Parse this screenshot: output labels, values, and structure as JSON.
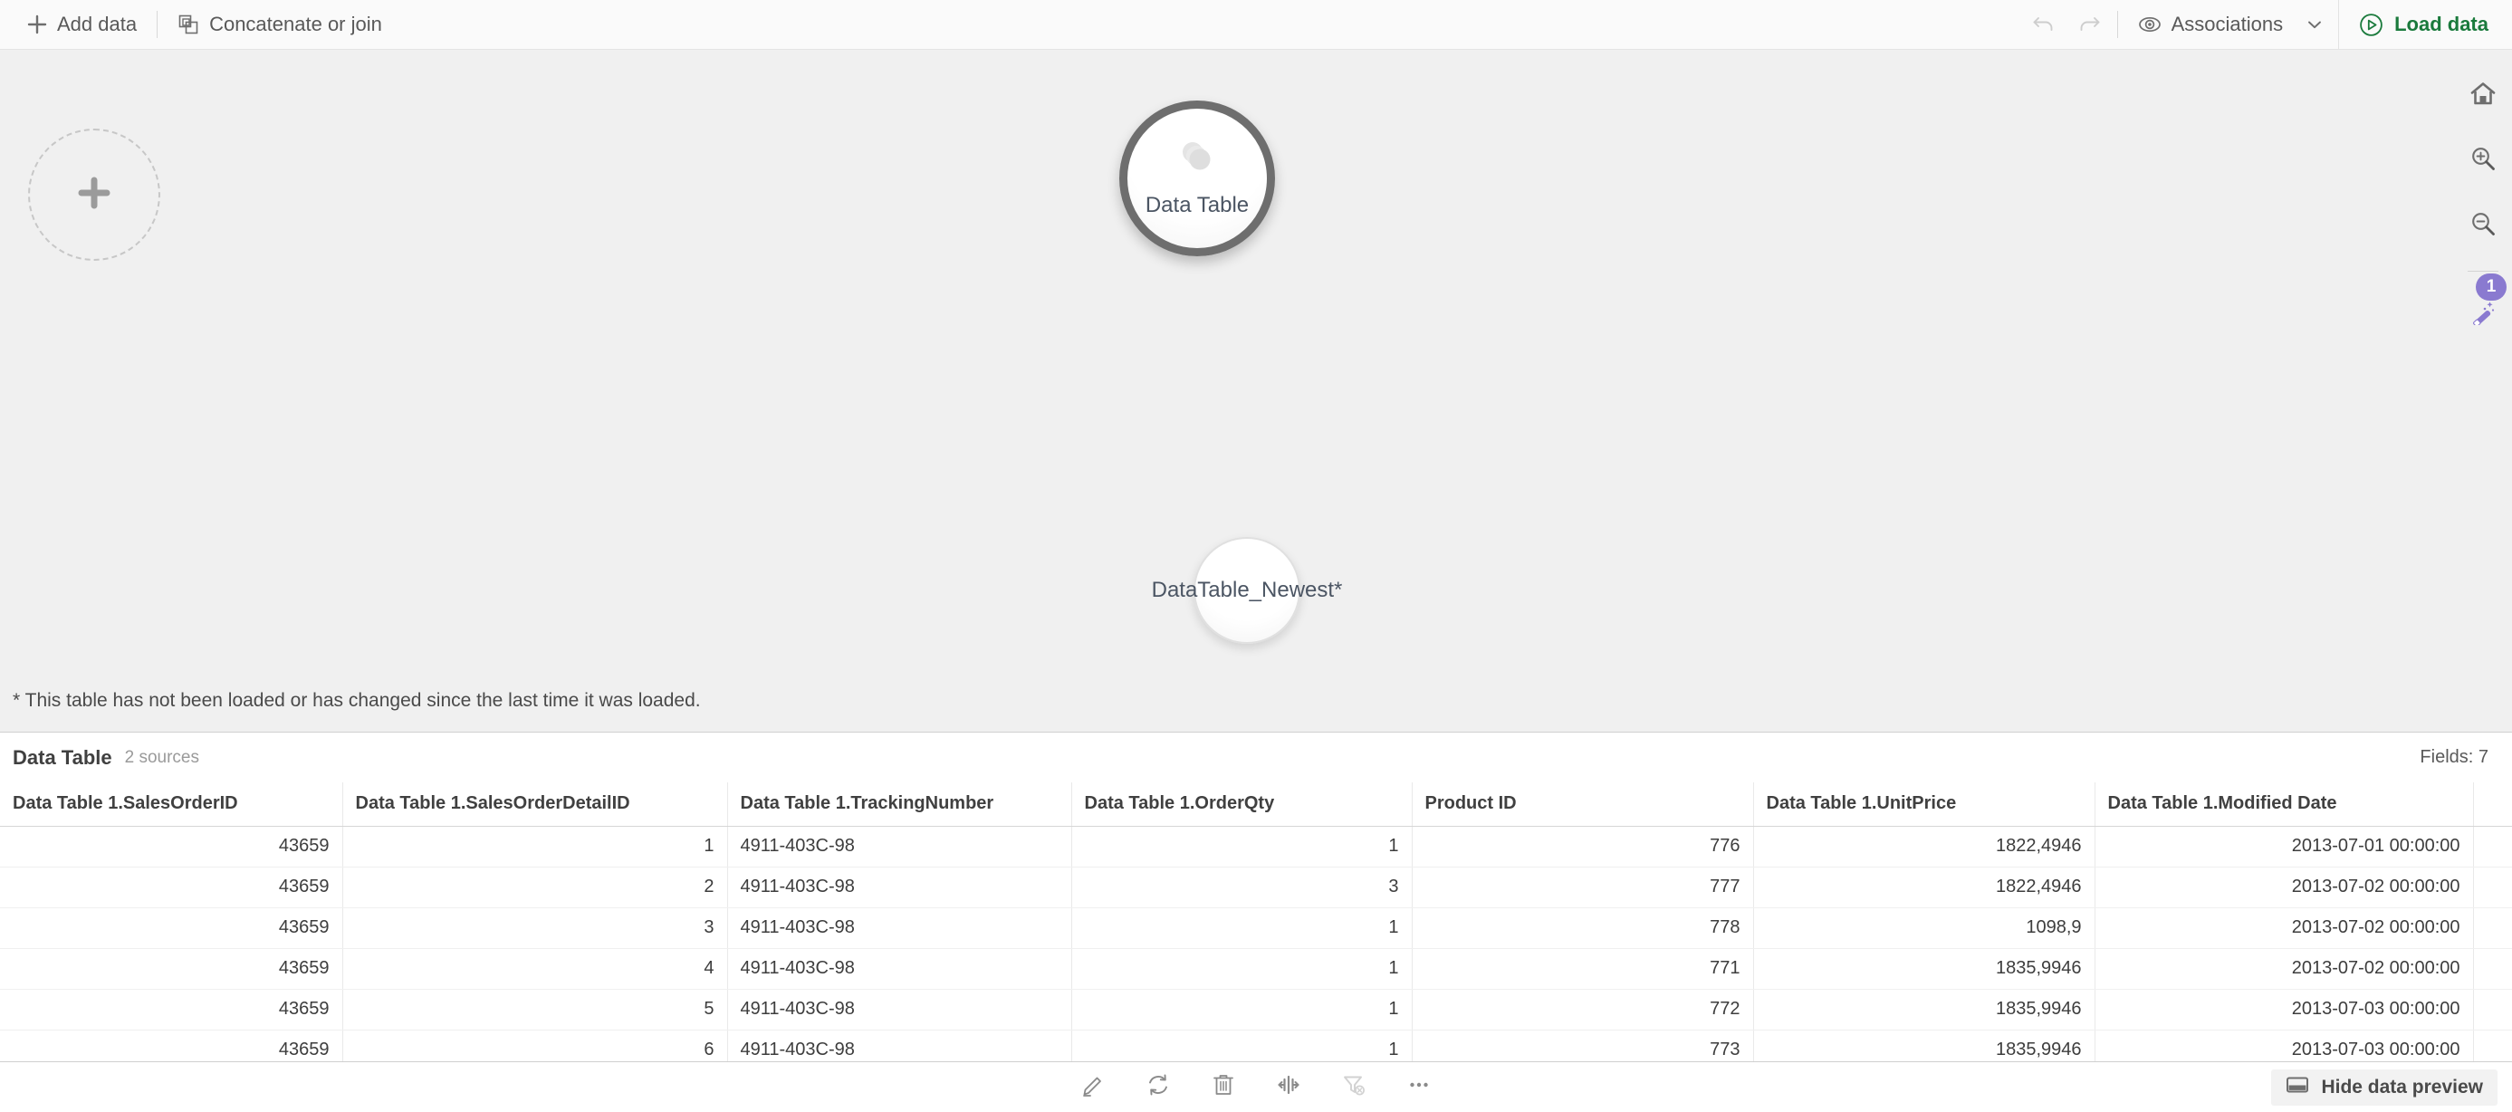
{
  "toolbar": {
    "add_data_label": "Add data",
    "add_data_icon": "plus-icon",
    "concat_label": "Concatenate or join",
    "concat_icon": "concatenate-icon",
    "undo_icon": "undo-icon",
    "redo_icon": "redo-icon",
    "associations_label": "Associations",
    "associations_icon": "eye-icon",
    "associations_caret_icon": "chevron-down-icon",
    "load_data_label": "Load data",
    "load_data_icon": "play-circle-icon",
    "accent_green": "#1a7a3c"
  },
  "canvas": {
    "add_bubble_icon": "plus-icon",
    "tables": [
      {
        "name": "Data Table",
        "selected": true,
        "icon": "stacked-discs-icon"
      },
      {
        "name": "DataTable_Newest*",
        "selected": false,
        "icon": ""
      }
    ],
    "footnote": "* This table has not been loaded or has changed since the last time it was loaded.",
    "background": "#f0f0f0"
  },
  "rail": {
    "home_icon": "home-icon",
    "zoom_in_icon": "zoom-in-icon",
    "zoom_out_icon": "zoom-out-icon",
    "wand_icon": "magic-wand-icon",
    "wand_badge": "1",
    "badge_color": "#8a7ad0"
  },
  "preview": {
    "title": "Data Table",
    "sources": "2 sources",
    "fields": "Fields: 7",
    "columns": [
      {
        "label": "Data Table 1.SalesOrderID",
        "align": "num"
      },
      {
        "label": "Data Table 1.SalesOrderDetailID",
        "align": "num"
      },
      {
        "label": "Data Table 1.TrackingNumber",
        "align": "txt"
      },
      {
        "label": "Data Table 1.OrderQty",
        "align": "num"
      },
      {
        "label": "Product ID",
        "align": "num"
      },
      {
        "label": "Data Table 1.UnitPrice",
        "align": "num"
      },
      {
        "label": "Data Table 1.Modified Date",
        "align": "num"
      },
      {
        "label": "",
        "align": "txt"
      }
    ],
    "rows": [
      [
        "43659",
        "1",
        "4911-403C-98",
        "1",
        "776",
        "1822,4946",
        "2013-07-01 00:00:00",
        ""
      ],
      [
        "43659",
        "2",
        "4911-403C-98",
        "3",
        "777",
        "1822,4946",
        "2013-07-02 00:00:00",
        ""
      ],
      [
        "43659",
        "3",
        "4911-403C-98",
        "1",
        "778",
        "1098,9",
        "2013-07-02 00:00:00",
        ""
      ],
      [
        "43659",
        "4",
        "4911-403C-98",
        "1",
        "771",
        "1835,9946",
        "2013-07-02 00:00:00",
        ""
      ],
      [
        "43659",
        "5",
        "4911-403C-98",
        "1",
        "772",
        "1835,9946",
        "2013-07-03 00:00:00",
        ""
      ],
      [
        "43659",
        "6",
        "4911-403C-98",
        "1",
        "773",
        "1835,9946",
        "2013-07-03 00:00:00",
        ""
      ]
    ]
  },
  "bottombar": {
    "edit_icon": "pencil-icon",
    "refresh_icon": "refresh-icon",
    "delete_icon": "trash-icon",
    "resize_icon": "resize-columns-icon",
    "clear_filter_icon": "clear-filter-icon",
    "more_icon": "more-icon",
    "hide_preview_label": "Hide data preview",
    "hide_preview_icon": "panel-icon"
  }
}
